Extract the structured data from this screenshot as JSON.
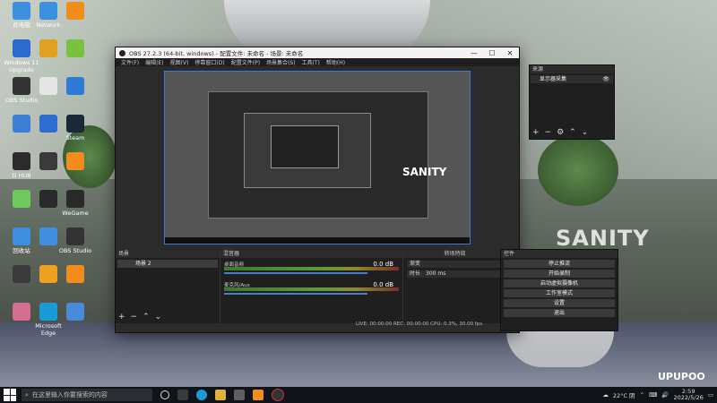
{
  "desktop": {
    "icons": [
      {
        "label": "此电脑",
        "color": "#3f8fe0"
      },
      {
        "label": "Windows 11 Upgrade",
        "color": "#2a6bd0"
      },
      {
        "label": "OBS Studio",
        "color": "#333333"
      },
      {
        "label": "",
        "color": "#3c7fd6"
      },
      {
        "label": "G HUB",
        "color": "#2b2b2b"
      },
      {
        "label": "",
        "color": "#6fc85c"
      },
      {
        "label": "回收站",
        "color": "#3f8fe0"
      },
      {
        "label": "",
        "color": "#3a3a3a"
      },
      {
        "label": "",
        "color": "#d46d8f"
      },
      {
        "label": "Network",
        "color": "#3f8fe0"
      },
      {
        "label": "",
        "color": "#e0a020"
      },
      {
        "label": "",
        "color": "#e5e5e5"
      },
      {
        "label": "",
        "color": "#2c6ed0"
      },
      {
        "label": "",
        "color": "#3a3a3a"
      },
      {
        "label": "",
        "color": "#2a2a2a"
      },
      {
        "label": "",
        "color": "#3f8fe0"
      },
      {
        "label": "",
        "color": "#f0a020"
      },
      {
        "label": "Microsoft Edge",
        "color": "#1a9bd7"
      },
      {
        "label": "",
        "color": "#f28c1c"
      },
      {
        "label": "",
        "color": "#7ac142"
      },
      {
        "label": "",
        "color": "#2d7bd6"
      },
      {
        "label": "Steam",
        "color": "#1b2838"
      },
      {
        "label": "",
        "color": "#f28c1c"
      },
      {
        "label": "WeGame",
        "color": "#2a2a2a"
      },
      {
        "label": "OBS Studio",
        "color": "#333333"
      },
      {
        "label": "",
        "color": "#f28c1c"
      },
      {
        "label": "",
        "color": "#4a8ad8"
      }
    ]
  },
  "wallpaper": {
    "overlay_text": "SANITY",
    "brand_text": "UPUPOO"
  },
  "obs": {
    "title": "OBS 27.2.3 (64-bit, windows) - 配置文件: 未命名 - 场景: 未命名",
    "title_controls": [
      "—",
      "☐",
      "✕"
    ],
    "menu": [
      "文件(F)",
      "编辑(E)",
      "视图(V)",
      "停靠窗口(D)",
      "配置文件(P)",
      "场景集合(S)",
      "工具(T)",
      "帮助(H)"
    ],
    "preview_overlay": "SANITY",
    "scenes": {
      "header": "场景",
      "items": [
        "场景 2"
      ]
    },
    "sources": {
      "header": "来源",
      "items": [
        "显示器采集"
      ]
    },
    "mixer": {
      "header": "混音器",
      "tracks": [
        {
          "name": "桌面音频",
          "volume_db": "0.0 dB"
        },
        {
          "name": "麦克风/Aux",
          "volume_db": "0.0 dB"
        }
      ]
    },
    "transitions": {
      "header": "转场特效",
      "type": "渐变",
      "duration_label": "时长",
      "duration_value": "300 ms"
    },
    "controls": {
      "header": "控件",
      "buttons": [
        "停止推流",
        "开始录制",
        "启动虚拟摄像机",
        "工作室模式",
        "设置",
        "退出"
      ]
    },
    "status_bar": "LIVE: 00:00:00   REC: 00:00:00   CPU: 0.3%, 30.00 fps"
  },
  "taskbar": {
    "search_placeholder": "在这里输入你要搜索的内容",
    "weather": "22°C 阴",
    "time": "2:59",
    "date": "2022/5/26"
  }
}
